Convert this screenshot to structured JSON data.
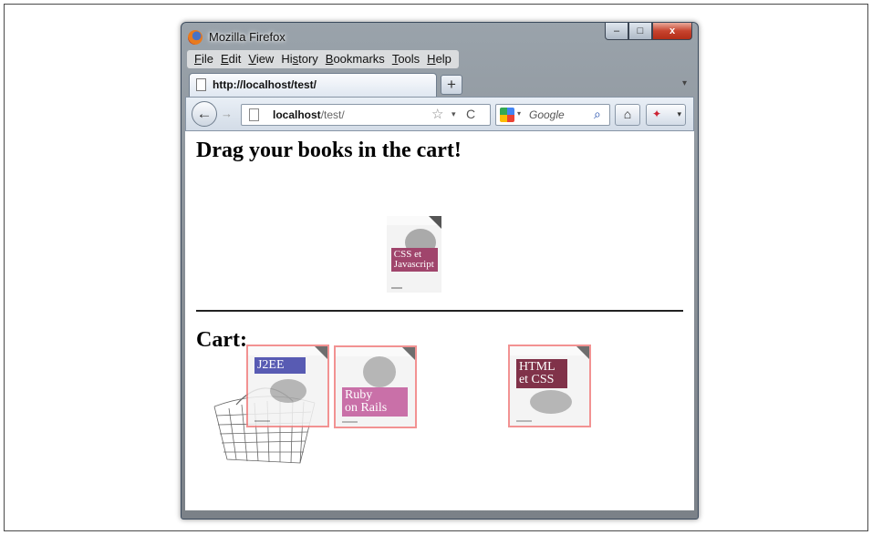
{
  "window": {
    "title": "Mozilla Firefox",
    "controls": {
      "minimize": "–",
      "maximize": "□",
      "close": "x"
    }
  },
  "menu": [
    "File",
    "Edit",
    "View",
    "History",
    "Bookmarks",
    "Tools",
    "Help"
  ],
  "menu_access_keys": [
    "F",
    "E",
    "V",
    "s",
    "B",
    "T",
    "H"
  ],
  "tab": {
    "label": "http://localhost/test/",
    "new_tab": "+"
  },
  "nav": {
    "back": "←",
    "forward": "→",
    "url_host": "localhost",
    "url_path": "/test/",
    "star": "☆",
    "reload": "C",
    "search_placeholder": "Google",
    "home": "⌂"
  },
  "page": {
    "heading": "Drag your books in the cart!",
    "cart_heading": "Cart:"
  },
  "books": {
    "available": [
      {
        "title_line1": "CSS et",
        "title_line2": "Javascript",
        "band_color": "#a0456c"
      }
    ],
    "in_cart": [
      {
        "title_line1": "J2EE",
        "title_line2": "",
        "band_color": "#3b3fa6"
      },
      {
        "title_line1": "Ruby",
        "title_line2": "on Rails",
        "band_color": "#c0589a"
      },
      {
        "title_line1": "HTML",
        "title_line2": "et CSS",
        "band_color": "#6b0f2a"
      }
    ]
  },
  "colors": {
    "cart_highlight": "#f08080"
  }
}
